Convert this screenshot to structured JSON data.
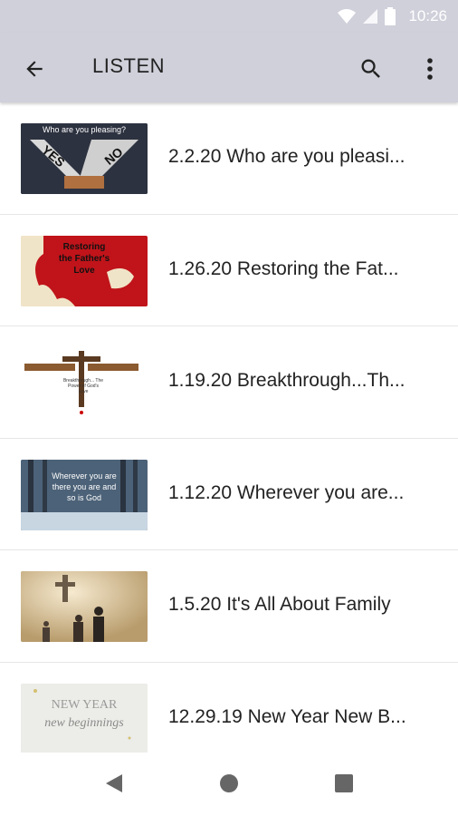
{
  "status_bar": {
    "time": "10:26"
  },
  "app_bar": {
    "title": "LISTEN"
  },
  "items": [
    {
      "title": "2.2.20 Who are you pleasi...",
      "thumb_text": "Who are you pleasing?",
      "thumb_yes": "YES",
      "thumb_no": "NO"
    },
    {
      "title": "1.26.20 Restoring the Fat...",
      "thumb_text": "Restoring the Father's Love"
    },
    {
      "title": "1.19.20 Breakthrough...Th...",
      "thumb_text": "Breakthrough... The Power of God's Love"
    },
    {
      "title": "1.12.20 Wherever you are...",
      "thumb_text": "Wherever you are there you are and so is God"
    },
    {
      "title": "1.5.20 It's All About Family"
    },
    {
      "title": "12.29.19 New Year New B...",
      "thumb_text1": "NEW YEAR",
      "thumb_text2": "new beginnings"
    }
  ]
}
